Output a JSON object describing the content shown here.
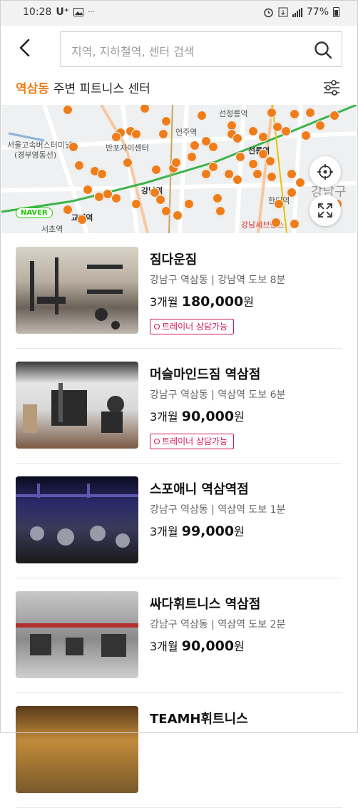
{
  "status_bar": {
    "time": "10:28",
    "carrier": "U⁺",
    "battery": "77%"
  },
  "search": {
    "placeholder": "지역, 지하철역, 센터 검색"
  },
  "location": {
    "area": "역삼동",
    "suffix": "주변 피트니스 센터"
  },
  "map": {
    "labels": [
      "선정릉역",
      "언주역",
      "반포",
      "반포자이센터",
      "서울고속버스터미널",
      "(경부영동선)",
      "강남역",
      "교대역",
      "서초역",
      "선릉역",
      "한티역",
      "강남세브란스",
      "강남구",
      "NAVER"
    ],
    "pin_color": "#ee7d1a"
  },
  "gyms": [
    {
      "name": "짐다운짐",
      "address": "강남구 역삼동 | 강남역 도보 8분",
      "price_prefix": "3개월",
      "price": "180,000",
      "price_unit": "원",
      "tag": "트레이너 상담가능"
    },
    {
      "name": "머슬마인드짐 역삼점",
      "address": "강남구 역삼동 | 역삼역 도보 6분",
      "price_prefix": "3개월",
      "price": "90,000",
      "price_unit": "원",
      "tag": "트레이너 상담가능"
    },
    {
      "name": "스포애니 역삼역점",
      "address": "강남구 역삼동 | 역삼역 도보 1분",
      "price_prefix": "3개월",
      "price": "99,000",
      "price_unit": "원",
      "tag": ""
    },
    {
      "name": "싸다휘트니스 역삼점",
      "address": "강남구 역삼동 | 역삼역 도보 2분",
      "price_prefix": "3개월",
      "price": "90,000",
      "price_unit": "원",
      "tag": ""
    },
    {
      "name": "TEAMH휘트니스",
      "address": "",
      "price_prefix": "",
      "price": "",
      "price_unit": "",
      "tag": ""
    }
  ],
  "colors": {
    "accent": "#ee7d1a",
    "tag": "#d11a5a"
  },
  "icons": [
    "back-arrow-icon",
    "search-icon",
    "filter-sliders-icon",
    "my-location-icon",
    "expand-icon",
    "alarm-icon",
    "signal-icon",
    "battery-icon"
  ]
}
